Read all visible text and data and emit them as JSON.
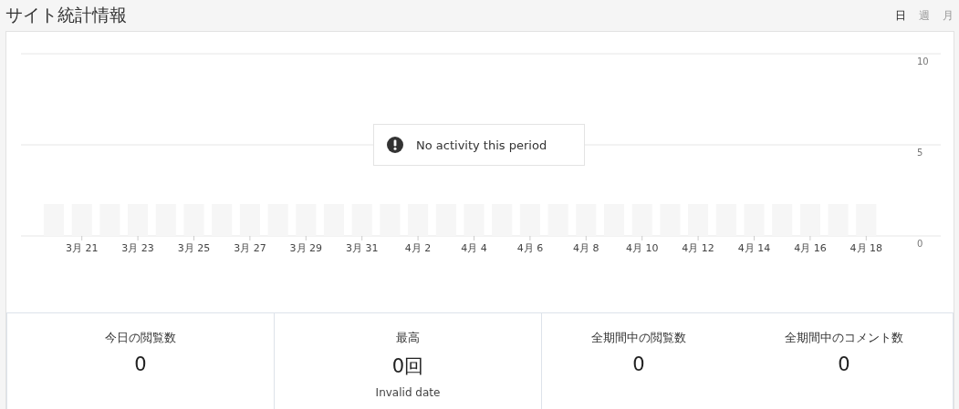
{
  "header": {
    "title": "サイト統計情報",
    "ranges": [
      {
        "label": "日",
        "selected": true
      },
      {
        "label": "週",
        "selected": false
      },
      {
        "label": "月",
        "selected": false
      }
    ]
  },
  "chart": {
    "message": "No activity this period",
    "chart_data": {
      "type": "bar",
      "yticks": [
        0,
        5,
        10
      ],
      "ylim": [
        0,
        10
      ],
      "categories": [
        "3月 21",
        "3月 23",
        "3月 25",
        "3月 27",
        "3月 29",
        "3月 31",
        "4月 2",
        "4月 4",
        "4月 6",
        "4月 8",
        "4月 10",
        "4月 12",
        "4月 14",
        "4月 16",
        "4月 18"
      ],
      "values": [
        0,
        0,
        0,
        0,
        0,
        0,
        0,
        0,
        0,
        0,
        0,
        0,
        0,
        0,
        0
      ]
    }
  },
  "stat_groups": [
    [
      {
        "label": "今日の閲覧数",
        "value": "0"
      }
    ],
    [
      {
        "label": "最高",
        "value": "0回",
        "note": "Invalid date"
      }
    ],
    [
      {
        "label": "全期間中の閲覧数",
        "value": "0"
      },
      {
        "label": "全期間中のコメント数",
        "value": "0"
      }
    ]
  ]
}
